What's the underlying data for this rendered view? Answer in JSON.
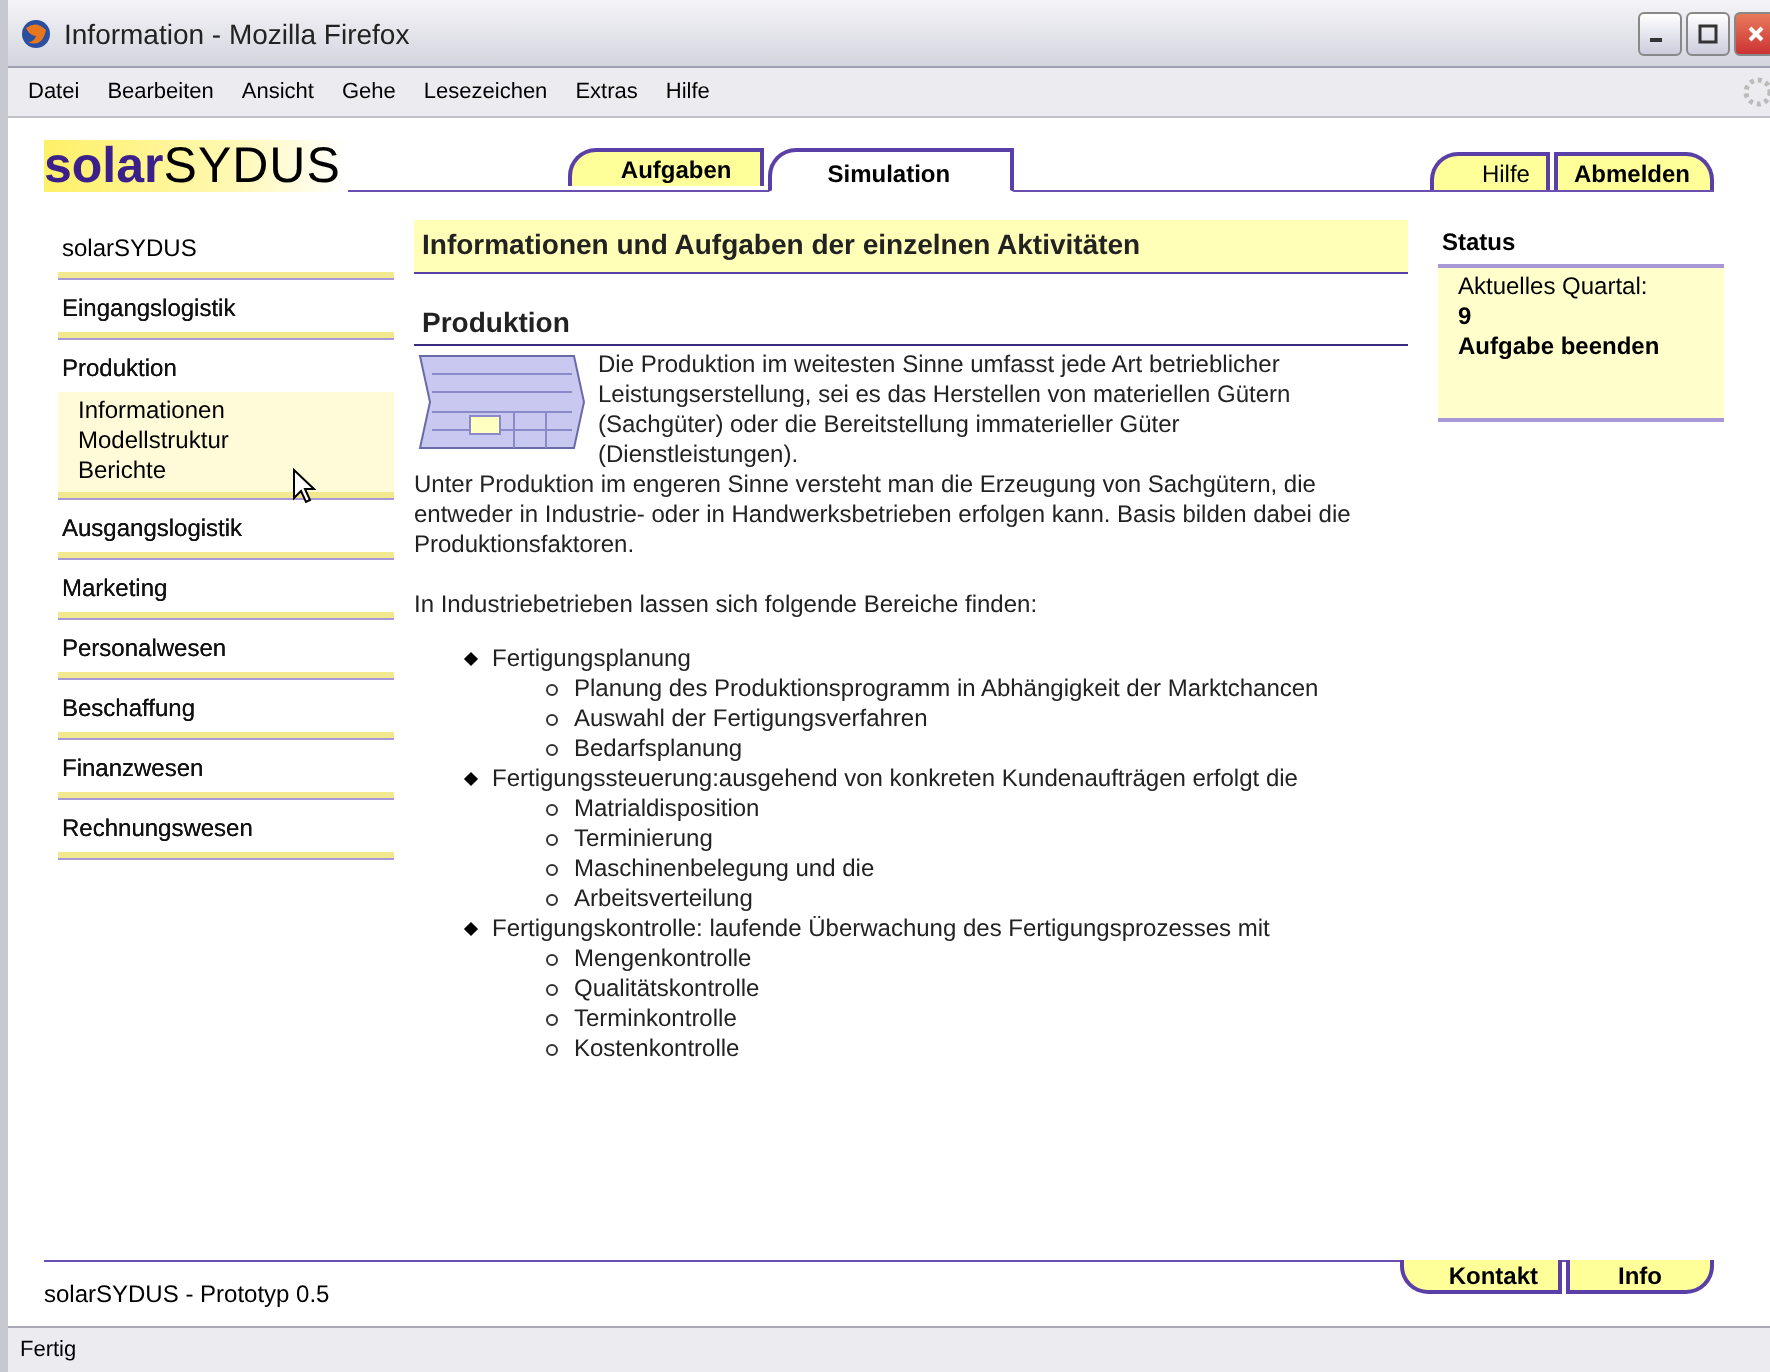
{
  "window": {
    "title": "Information - Mozilla Firefox"
  },
  "menu": [
    "Datei",
    "Bearbeiten",
    "Ansicht",
    "Gehe",
    "Lesezeichen",
    "Extras",
    "Hilfe"
  ],
  "logo": {
    "part1": "solar",
    "part2": "SYDUS"
  },
  "tabs": [
    {
      "label": "Aufgaben",
      "selected": false
    },
    {
      "label": "Simulation",
      "selected": true
    }
  ],
  "top_links": [
    "Hilfe",
    "Abmelden"
  ],
  "sidebar": {
    "items": [
      {
        "label": "solarSYDUS"
      },
      {
        "label": "Eingangslogistik"
      },
      {
        "label": "Produktion",
        "children": [
          {
            "label": "Informationen"
          },
          {
            "label": "Modellstruktur"
          },
          {
            "label": "Berichte"
          }
        ]
      },
      {
        "label": "Ausgangslogistik"
      },
      {
        "label": "Marketing"
      },
      {
        "label": "Personalwesen"
      },
      {
        "label": "Beschaffung"
      },
      {
        "label": "Finanzwesen"
      },
      {
        "label": "Rechnungswesen"
      }
    ]
  },
  "main": {
    "heading": "Informationen und Aufgaben der einzelnen Aktivitäten",
    "section": "Produktion",
    "intro": "Die Produktion im weitesten Sinne umfasst jede Art betrieblicher Leistungserstellung, sei es das Herstellen von materiellen Gütern (Sachgüter) oder die Bereitstellung immaterieller Güter (Dienstleistungen).",
    "paragraph": "Unter Produktion im engeren Sinne versteht man die Erzeugung von Sachgütern, die entweder in Industrie- oder in Handwerksbetrieben erfolgen kann. Basis bilden dabei die Produktionsfaktoren.",
    "list_intro": "In Industriebetrieben lassen sich folgende Bereiche finden:",
    "areas": [
      {
        "label": "Fertigungsplanung",
        "children": [
          {
            "label": "Planung des Produktionsprogramm in Abhängigkeit der Marktchancen"
          },
          {
            "label": "Auswahl der Fertigungsverfahren"
          },
          {
            "label": "Bedarfsplanung"
          }
        ]
      },
      {
        "label": "Fertigungssteuerung:ausgehend von konkreten Kundenaufträgen erfolgt die",
        "children": [
          {
            "label": "Matrialdisposition"
          },
          {
            "label": "Terminierung"
          },
          {
            "label": "Maschinenbelegung und die"
          },
          {
            "label": "Arbeitsverteilung"
          }
        ]
      },
      {
        "label": "Fertigungskontrolle: laufende Überwachung des Fertigungsprozesses mit",
        "children": [
          {
            "label": "Mengenkontrolle"
          },
          {
            "label": "Qualitätskontrolle"
          },
          {
            "label": "Terminkontrolle"
          },
          {
            "label": "Kostenkontrolle"
          }
        ]
      }
    ]
  },
  "status": {
    "title": "Status",
    "quarter_label": "Aktuelles Quartal:",
    "quarter": "9",
    "action": "Aufgabe beenden"
  },
  "footer": {
    "text": "solarSYDUS - Prototyp 0.5",
    "links": [
      "Kontakt",
      "Info"
    ]
  },
  "status_bar": "Fertig"
}
